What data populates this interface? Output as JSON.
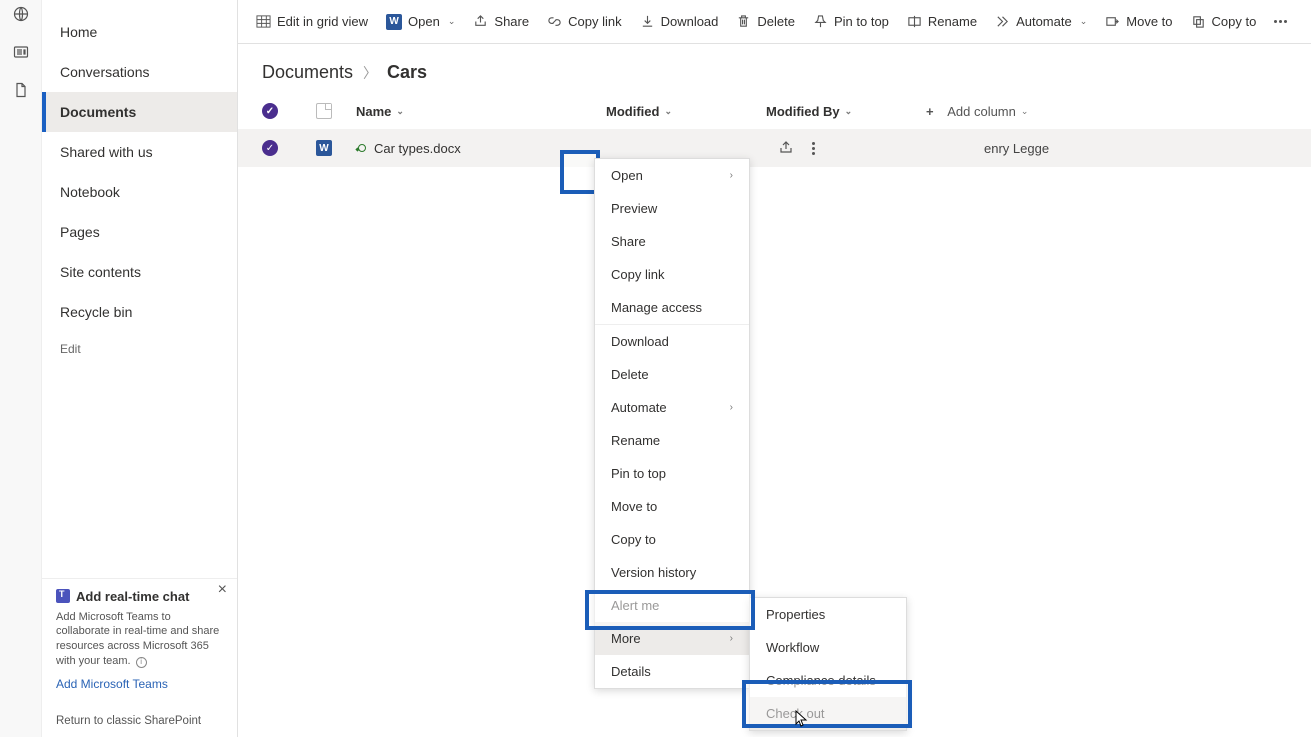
{
  "rail": {
    "icons": [
      "globe",
      "news",
      "document"
    ]
  },
  "sidebar": {
    "items": [
      {
        "label": "Home"
      },
      {
        "label": "Conversations"
      },
      {
        "label": "Documents",
        "active": true
      },
      {
        "label": "Shared with us"
      },
      {
        "label": "Notebook"
      },
      {
        "label": "Pages"
      },
      {
        "label": "Site contents"
      },
      {
        "label": "Recycle bin"
      }
    ],
    "edit": "Edit",
    "promo": {
      "title": "Add real-time chat",
      "desc": "Add Microsoft Teams to collaborate in real-time and share resources across Microsoft 365 with your team.",
      "link": "Add Microsoft Teams"
    },
    "return": "Return to classic SharePoint"
  },
  "toolbar": {
    "edit_grid": "Edit in grid view",
    "open": "Open",
    "share": "Share",
    "copy_link": "Copy link",
    "download": "Download",
    "delete": "Delete",
    "pin": "Pin to top",
    "rename": "Rename",
    "automate": "Automate",
    "move": "Move to",
    "copy_to": "Copy to"
  },
  "breadcrumb": {
    "root": "Documents",
    "current": "Cars"
  },
  "columns": {
    "name": "Name",
    "modified": "Modified",
    "modified_by": "Modified By",
    "add": "Add column"
  },
  "rows": [
    {
      "name": "Car types.docx",
      "modified_by_partial": "enry Legge"
    }
  ],
  "context_menu": {
    "open": "Open",
    "preview": "Preview",
    "share": "Share",
    "copy_link": "Copy link",
    "manage_access": "Manage access",
    "download": "Download",
    "delete": "Delete",
    "automate": "Automate",
    "rename": "Rename",
    "pin": "Pin to top",
    "move": "Move to",
    "copy_to": "Copy to",
    "version": "Version history",
    "alert": "Alert me",
    "more": "More",
    "details": "Details"
  },
  "sub_menu": {
    "properties": "Properties",
    "workflow": "Workflow",
    "compliance": "Compliance details",
    "checkout": "Check out"
  }
}
